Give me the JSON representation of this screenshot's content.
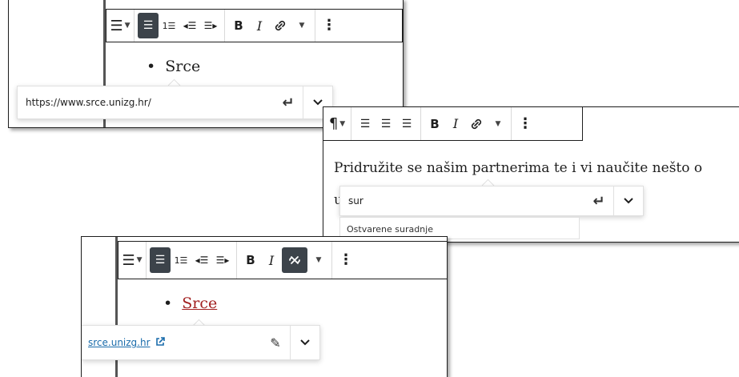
{
  "panel1": {
    "list_item": "Srce",
    "url_value": "https://www.srce.unizg.hr/"
  },
  "panel2": {
    "paragraph": "Pridružite se našim partnerima te i vi naučite nešto o",
    "next_line_start": "u",
    "search_value": "sur",
    "suggestion": "Ostvarene suradnje"
  },
  "panel3": {
    "list_item": "Srce",
    "link_display": "srce.unizg.hr"
  },
  "icons": {
    "list": "☰",
    "caret": "▾",
    "bold": "B",
    "italic": "I",
    "link": "🔗",
    "more": "⋮",
    "paragraph": "¶",
    "enter": "↵",
    "chevron": "⌄",
    "pencil": "✎"
  }
}
